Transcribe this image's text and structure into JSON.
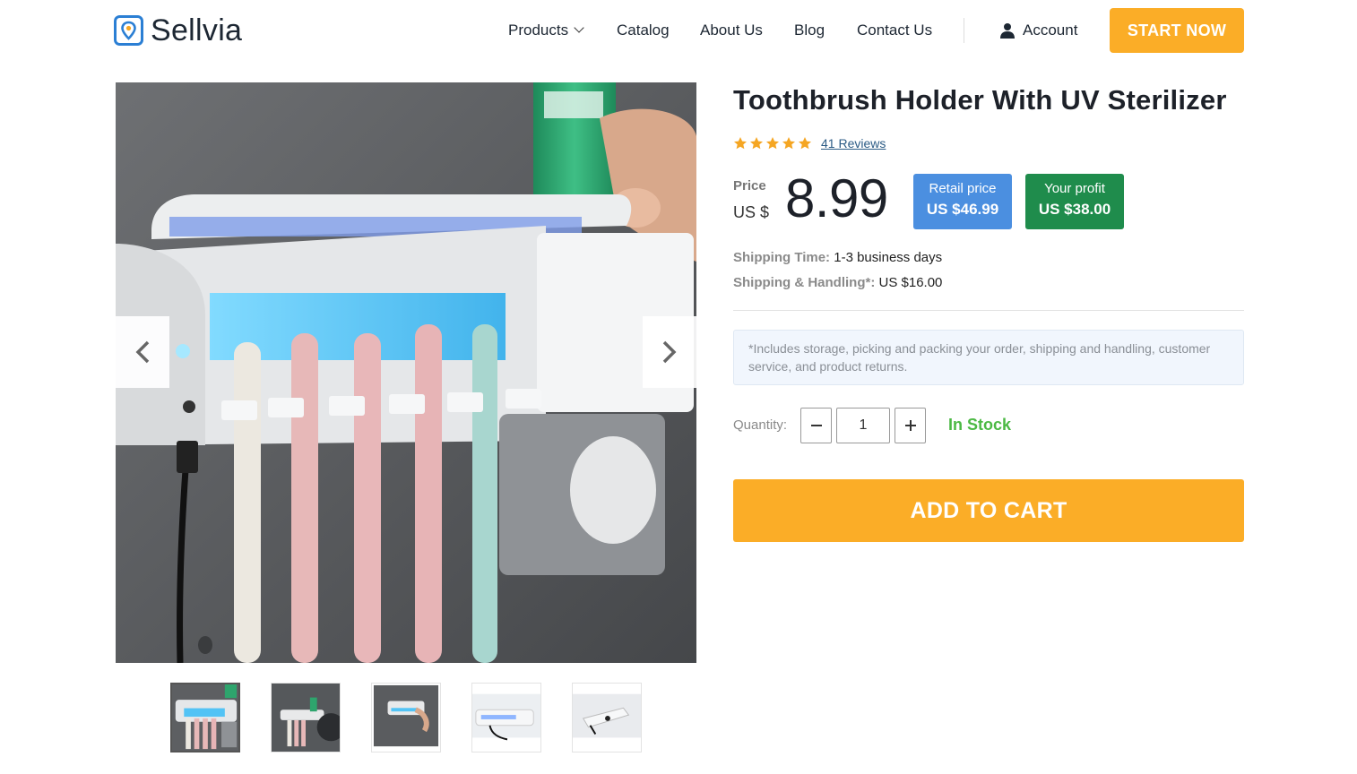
{
  "brand": {
    "name": "Sellvia",
    "logo_icon": "location-pin-logo",
    "accent": "#2b7fd4"
  },
  "nav": {
    "items": [
      {
        "label": "Products",
        "has_dropdown": true
      },
      {
        "label": "Catalog"
      },
      {
        "label": "About Us"
      },
      {
        "label": "Blog"
      },
      {
        "label": "Contact Us"
      }
    ],
    "account_label": "Account",
    "cta_label": "START NOW"
  },
  "product": {
    "title": "Toothbrush Holder With UV Sterilizer",
    "rating": 5,
    "reviews_label": "41 Reviews",
    "price_label": "Price",
    "price_currency": "US $",
    "price_value": "8.99",
    "retail_label": "Retail price",
    "retail_value": "US $46.99",
    "profit_label": "Your profit",
    "profit_value": "US $38.00",
    "shipping_time_label": "Shipping Time:",
    "shipping_time_value": "1-3 business days",
    "shipping_handling_label": "Shipping & Handling*:",
    "shipping_handling_value": "US $16.00",
    "note": "*Includes storage, picking and packing your order, shipping and handling, customer service, and product returns.",
    "quantity_label": "Quantity:",
    "quantity_value": "1",
    "stock_label": "In Stock",
    "cart_label": "ADD TO CART"
  },
  "gallery": {
    "image_count": 5,
    "active_index": 0
  },
  "colors": {
    "cta": "#fbad27",
    "retail_badge": "#4b8fe0",
    "profit_badge": "#1f8c4c",
    "in_stock": "#4cb944",
    "star": "#f5a623"
  }
}
